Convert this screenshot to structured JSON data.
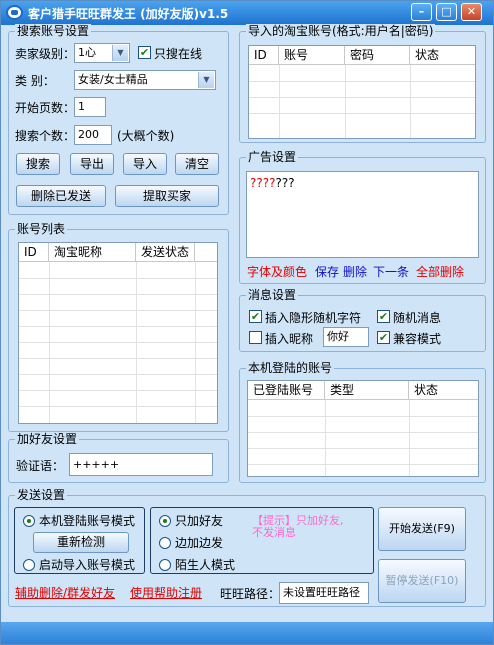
{
  "window": {
    "title": "客户猎手旺旺群发王 (加好友版)v1.5"
  },
  "search": {
    "group_label": "搜索账号设置",
    "seller_level_label": "卖家级别：",
    "seller_level_value": "1心",
    "only_online_label": "只搜在线",
    "only_online_checked": true,
    "category_label": "类    别：",
    "category_value": "女装/女士精品",
    "start_page_label": "开始页数：",
    "start_page_value": "1",
    "search_count_label": "搜索个数：",
    "search_count_value": "200",
    "search_count_hint": "(大概个数)",
    "buttons": {
      "search": "搜索",
      "export": "导出",
      "import": "导入",
      "clear": "清空",
      "delete_sent": "删除已发送",
      "extract_buyers": "提取买家"
    }
  },
  "account_list": {
    "group_label": "账号列表",
    "columns": [
      "ID",
      "淘宝昵称",
      "发送状态"
    ]
  },
  "add_friend": {
    "group_label": "加好友设置",
    "verify_label": "验证语：",
    "verify_value": "+++++"
  },
  "imported": {
    "group_label": "导入的淘宝账号(格式:用户名|密码)",
    "columns": [
      "ID",
      "账号",
      "密码",
      "状态"
    ]
  },
  "ads": {
    "group_label": "广告设置",
    "text_prefix": "????",
    "text_rest": "???",
    "actions": {
      "font_color": "字体及颜色",
      "save": "保存",
      "delete": "删除",
      "next": "下一条",
      "delete_all": "全部删除"
    },
    "colors": {
      "red": "#e00000",
      "blue": "#1010c0"
    }
  },
  "message": {
    "group_label": "消息设置",
    "insert_random_label": "插入隐形随机字符",
    "insert_random_checked": true,
    "random_msg_label": "随机消息",
    "random_msg_checked": true,
    "insert_nick_label": "插入昵称",
    "insert_nick_checked": false,
    "nick_value": "你好",
    "compat_label": "兼容模式",
    "compat_checked": true
  },
  "local_accounts": {
    "group_label": "本机登陆的账号",
    "columns": [
      "已登陆账号",
      "类型",
      "状态"
    ]
  },
  "send": {
    "group_label": "发送设置",
    "mode_local_label": "本机登陆账号模式",
    "redetect_label": "重新检测",
    "mode_import_label": "启动导入账号模式",
    "only_add_label": "只加好友",
    "add_send_label": "边加边发",
    "stranger_label": "陌生人模式",
    "tip_line1": "【提示】只加好友,",
    "tip_line2": "不发消息",
    "start_label": "开始发送(F9)",
    "pause_label": "暂停发送(F10)",
    "link_helper": "辅助删除/群发好友",
    "link_help": "使用帮助注册",
    "ww_path_label": "旺旺路径：",
    "ww_path_value": "未设置旺旺路径"
  }
}
